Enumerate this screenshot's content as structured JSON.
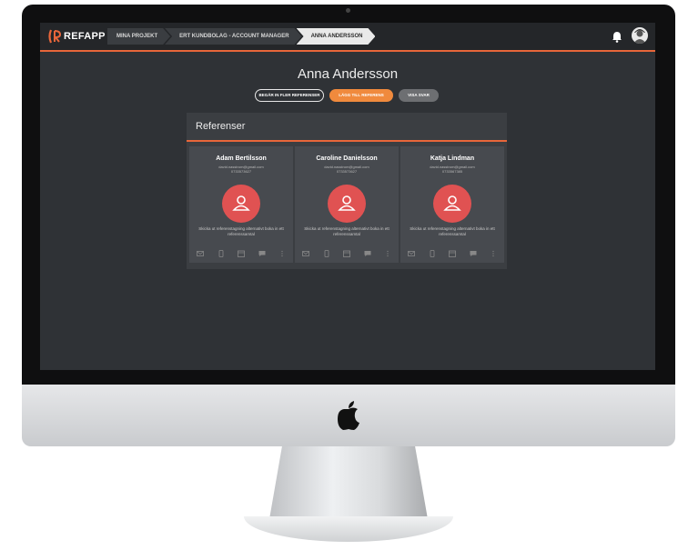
{
  "app": {
    "logo_text": "REFAPP"
  },
  "breadcrumb": [
    {
      "label": "MINA PROJEKT"
    },
    {
      "label": "ERT KUNDBOLAG - ACCOUNT MANAGER"
    },
    {
      "label": "ANNA ANDERSSON"
    }
  ],
  "header": {
    "bell_icon": "bell-icon",
    "avatar_icon": "user-avatar-icon"
  },
  "page": {
    "title": "Anna Andersson",
    "actions": {
      "request_more": "BEGÄR IN FLER REFERENSER",
      "add_reference": "LÄGG TILL REFERENS",
      "show_more": "VISA SVAR"
    }
  },
  "panel": {
    "title": "Referenser"
  },
  "references": [
    {
      "name": "Adam Bertilsson",
      "email": "david.nasstrom@gmail.com",
      "phone": "0733573627",
      "text": "Skicka ut referenstagning alternativt boka in ett referenssamtal"
    },
    {
      "name": "Caroline Danielsson",
      "email": "david.nasstrom@gmail.com",
      "phone": "0733573627",
      "text": "Skicka ut referenstagning alternativt boka in ett referenssamtal"
    },
    {
      "name": "Katja Lindman",
      "email": "david.nasstrom@gmail.com",
      "phone": "0733567385",
      "text": "Skicka ut referenstagning alternativt boka in ett referenssamtal"
    }
  ],
  "card_icons": [
    "mail-icon",
    "phone-icon",
    "calendar-icon",
    "chat-icon",
    "more-icon"
  ],
  "colors": {
    "accent": "#e8663a",
    "orange_button": "#f08a3d",
    "avatar_red": "#e05252",
    "background": "#2f3236"
  }
}
